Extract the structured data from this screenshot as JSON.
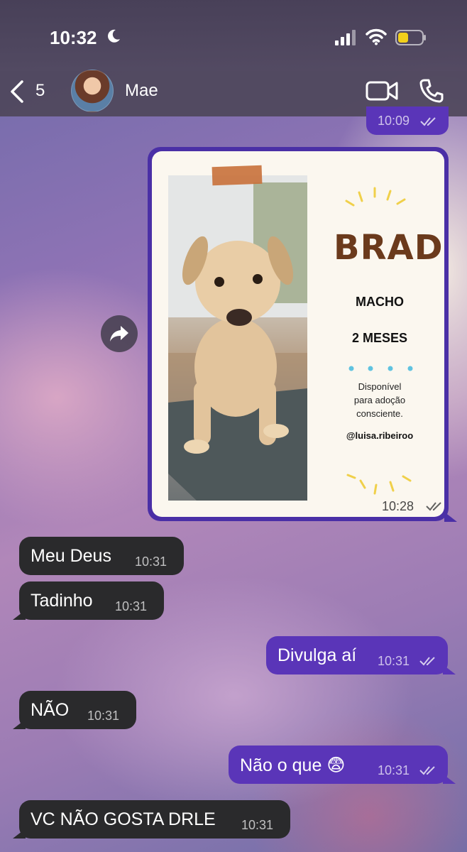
{
  "status": {
    "time": "10:32"
  },
  "header": {
    "back_count": "5",
    "contact_name": "Mae"
  },
  "prev_message": {
    "time": "10:09"
  },
  "image_message": {
    "time": "10:28",
    "card": {
      "name": "BRAD",
      "sex": "MACHO",
      "age": "2 MESES",
      "text_line1": "Disponível",
      "text_line2": "para adoção",
      "text_line3": "consciente.",
      "handle": "@luisa.ribeiroo"
    }
  },
  "messages": [
    {
      "dir": "in",
      "text": "Meu Deus",
      "time": "10:31"
    },
    {
      "dir": "in",
      "text": "Tadinho",
      "time": "10:31"
    },
    {
      "dir": "out",
      "text": "Divulga aí",
      "time": "10:31"
    },
    {
      "dir": "in",
      "text": "NÃO",
      "time": "10:31"
    },
    {
      "dir": "out",
      "text": "Não o que 😨",
      "time": "10:31"
    },
    {
      "dir": "in",
      "text": "VC NÃO GOSTA DRLE",
      "time": "10:31"
    }
  ],
  "colors": {
    "outgoing": "#5a35b8",
    "incoming": "#2a2a2c",
    "brad_brown": "#6b3a1c",
    "battery": "#f2d01b"
  }
}
